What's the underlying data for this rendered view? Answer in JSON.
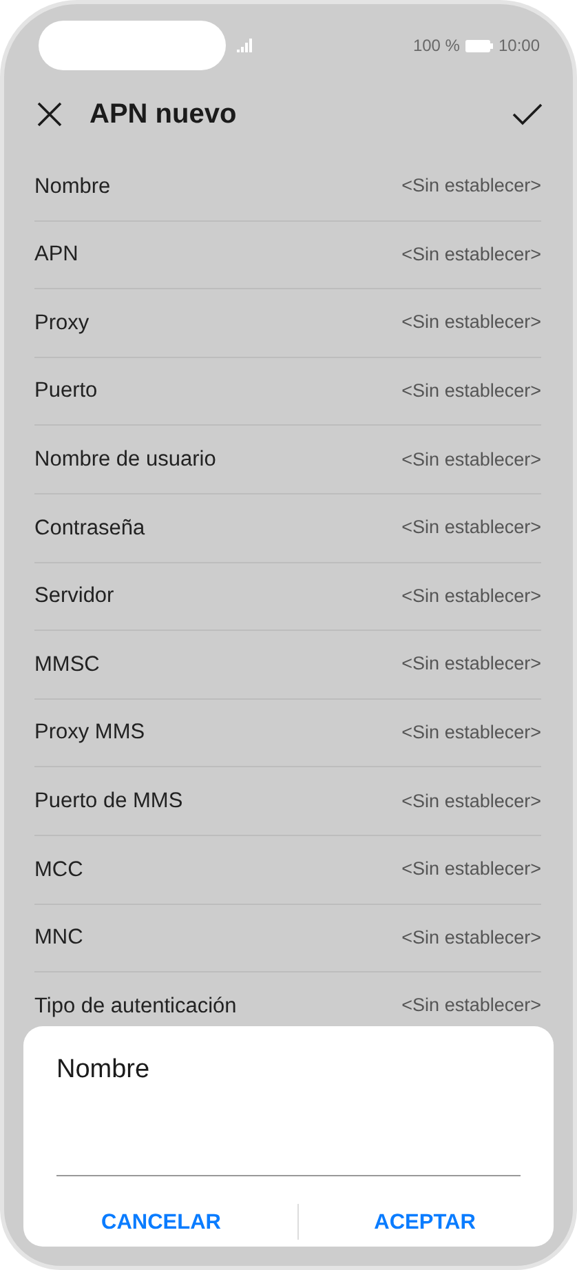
{
  "status_bar": {
    "battery_text": "100 %",
    "time": "10:00"
  },
  "header": {
    "title": "APN nuevo"
  },
  "settings": [
    {
      "label": "Nombre",
      "value": "<Sin establecer>"
    },
    {
      "label": "APN",
      "value": "<Sin establecer>"
    },
    {
      "label": "Proxy",
      "value": "<Sin establecer>"
    },
    {
      "label": "Puerto",
      "value": "<Sin establecer>"
    },
    {
      "label": "Nombre de usuario",
      "value": "<Sin establecer>"
    },
    {
      "label": "Contraseña",
      "value": "<Sin establecer>"
    },
    {
      "label": "Servidor",
      "value": "<Sin establecer>"
    },
    {
      "label": "MMSC",
      "value": "<Sin establecer>"
    },
    {
      "label": "Proxy MMS",
      "value": "<Sin establecer>"
    },
    {
      "label": "Puerto de MMS",
      "value": "<Sin establecer>"
    },
    {
      "label": "MCC",
      "value": "<Sin establecer>"
    },
    {
      "label": "MNC",
      "value": "<Sin establecer>"
    },
    {
      "label": "Tipo de autenticación",
      "value": "<Sin establecer>"
    }
  ],
  "dialog": {
    "title": "Nombre",
    "buttons": [
      "CANCELAR",
      "ACEPTAR"
    ]
  }
}
